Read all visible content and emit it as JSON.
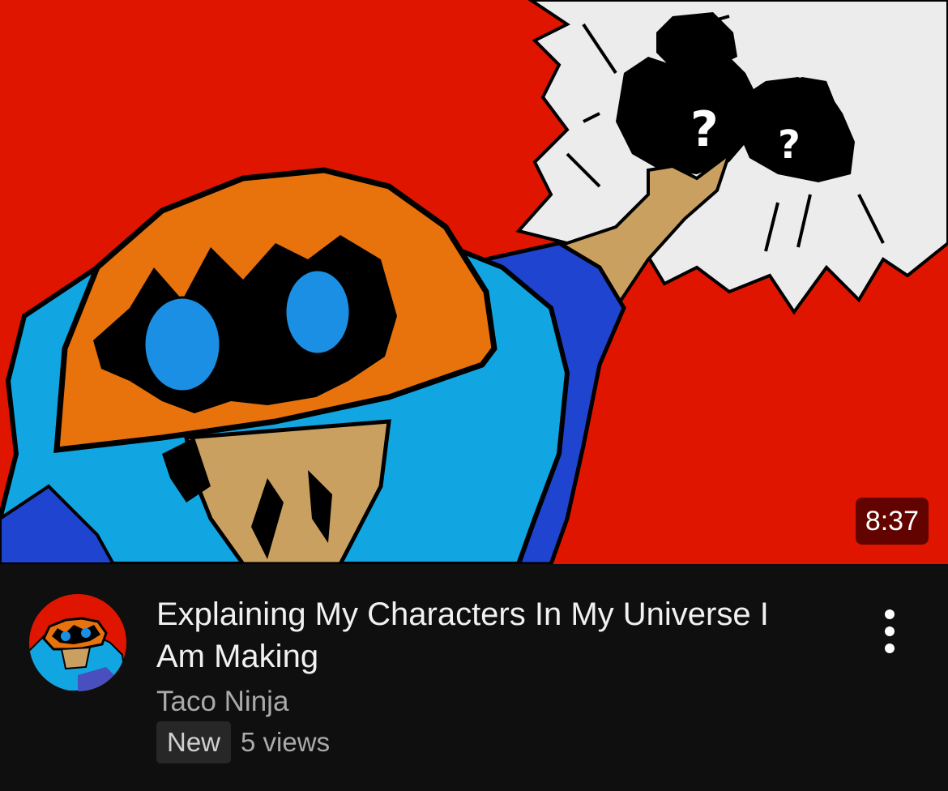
{
  "video": {
    "duration": "8:37",
    "title": "Explaining My Characters In My Universe I Am Making",
    "channel": "Taco Ninja",
    "badge": "New",
    "views": "5 views"
  },
  "icons": {
    "menu": "more-vert-icon"
  },
  "colors": {
    "background": "#0f0f0f",
    "thumbnail_red": "#e01500",
    "character_orange": "#e8720c",
    "character_blue": "#11a6e2",
    "eye_blue": "#1a8fe3",
    "skin": "#c9a05f",
    "duration_bg": "#5c0500"
  }
}
